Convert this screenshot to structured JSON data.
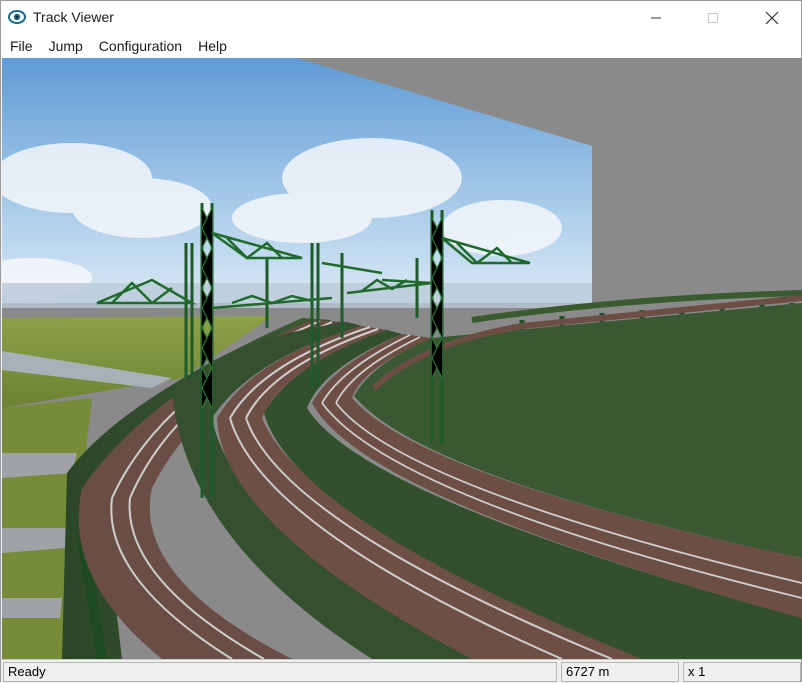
{
  "window": {
    "title": "Track Viewer",
    "app_icon": "eye-icon",
    "controls": {
      "minimize_icon": "minimize-icon",
      "maximize_icon": "maximize-icon",
      "close_icon": "close-icon"
    }
  },
  "menu": {
    "items": [
      {
        "label": "File"
      },
      {
        "label": "Jump"
      },
      {
        "label": "Configuration"
      },
      {
        "label": "Help"
      }
    ]
  },
  "viewport": {
    "description_scene": "3d-railway-track-view",
    "colors": {
      "sky_top": "#6fa8dc",
      "sky_bottom": "#cfe2f3",
      "grass": "#7a8f3c",
      "structure": "#2f4a2a",
      "catenary": "#1f5a2a",
      "rail": "#6b4a40",
      "backdrop": "#8a8a8a"
    }
  },
  "status": {
    "message": "Ready",
    "distance": "6727 m",
    "zoom": "x 1"
  }
}
